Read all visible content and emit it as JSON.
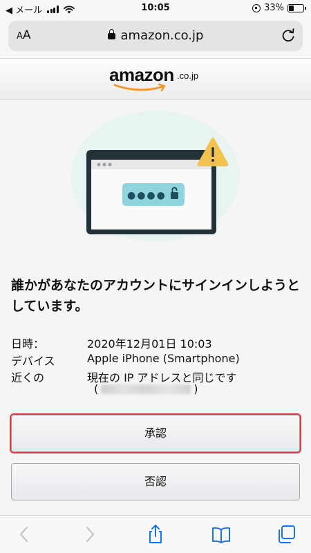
{
  "status_bar": {
    "carrier_back": "◀ メール",
    "time": "10:05",
    "battery_percent": "33%",
    "battery_level": 0.33
  },
  "browser": {
    "text_size_button": "AA",
    "url": "amazon.co.jp"
  },
  "brand": {
    "logo_word": "amazon",
    "logo_tld": ".co.jp",
    "smile_color": "#f19a2b"
  },
  "alert": {
    "headline": "誰かがあなたのアカウントにサインインしようとしています。",
    "details": [
      {
        "label": "日時：",
        "value": "2020年12月01日 10:03"
      },
      {
        "label": "デバイス",
        "value": "Apple iPhone (Smartphone)"
      },
      {
        "label": "近くの",
        "value": "現在の IP アドレスと同じです"
      }
    ],
    "ip_open": "(",
    "ip_close": ")",
    "password_dots": "●●●●",
    "warning_icon": "warning-triangle-icon",
    "colors": {
      "accent_teal": "#8fd3dc",
      "warning_yellow": "#f2c14e",
      "frame_dark": "#233138"
    }
  },
  "actions": {
    "approve_label": "承認",
    "deny_label": "否認"
  },
  "toolbar": {
    "icons": [
      "back-icon",
      "forward-icon",
      "share-icon",
      "bookmarks-icon",
      "tabs-icon"
    ],
    "accent": "#1a73e8"
  }
}
